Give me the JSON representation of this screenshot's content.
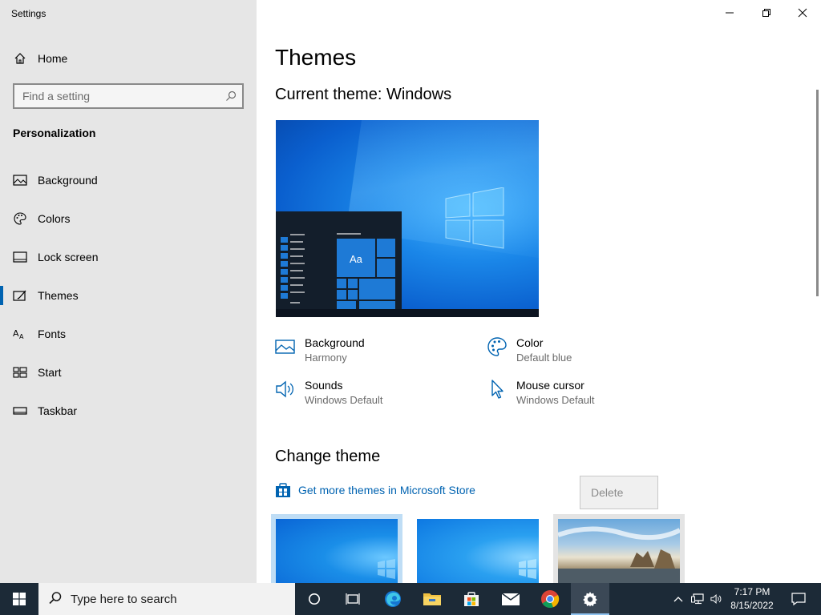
{
  "app": {
    "title": "Settings"
  },
  "sidebar": {
    "home_label": "Home",
    "search_placeholder": "Find a setting",
    "section": "Personalization",
    "items": [
      {
        "label": "Background",
        "icon": "image-icon"
      },
      {
        "label": "Colors",
        "icon": "palette-icon"
      },
      {
        "label": "Lock screen",
        "icon": "lock-screen-icon"
      },
      {
        "label": "Themes",
        "icon": "themes-icon",
        "active": true
      },
      {
        "label": "Fonts",
        "icon": "fonts-icon"
      },
      {
        "label": "Start",
        "icon": "start-icon"
      },
      {
        "label": "Taskbar",
        "icon": "taskbar-icon"
      }
    ]
  },
  "main": {
    "title": "Themes",
    "current_theme": "Current theme: Windows",
    "preview_sample": "Aa",
    "properties": {
      "background": {
        "title": "Background",
        "value": "Harmony"
      },
      "color": {
        "title": "Color",
        "value": "Default blue"
      },
      "sounds": {
        "title": "Sounds",
        "value": "Windows Default"
      },
      "cursor": {
        "title": "Mouse cursor",
        "value": "Windows Default"
      }
    },
    "change_theme": "Change theme",
    "store_link": "Get more themes in Microsoft Store",
    "delete_label": "Delete"
  },
  "taskbar": {
    "search_placeholder": "Type here to search",
    "time": "7:17 PM",
    "date": "8/15/2022"
  },
  "colors": {
    "accent": "#0063b1",
    "sidebar_bg": "#e6e6e6",
    "taskbar_bg": "#1c2a37"
  }
}
